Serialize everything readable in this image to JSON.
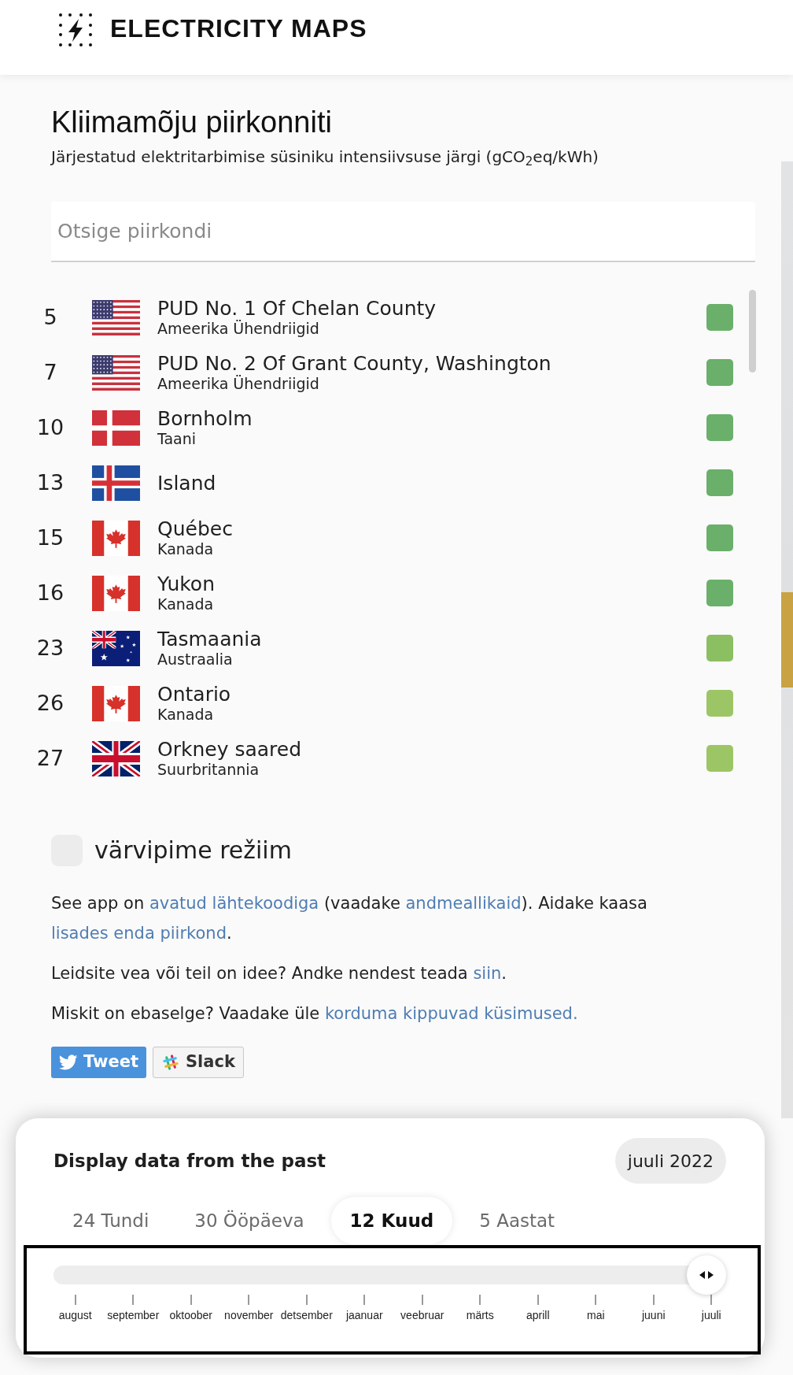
{
  "header": {
    "logo_text": "ELECTRICITY MAPS"
  },
  "ranking": {
    "title": "Kliimamõju piirkonniti",
    "subtitle": "Järjestatud elektritarbimise süsiniku intensiivsuse järgi (gCO$_{2}$eq/kWh)",
    "search": {
      "placeholder": "Otsige piirkondi"
    },
    "zones": [
      {
        "rank": "5",
        "kind": "us",
        "name": "PUD No. 1 Of Chelan County",
        "country": "Ameerika Ühendriigid",
        "color": "#6aaf6a"
      },
      {
        "rank": "7",
        "kind": "us",
        "name": "PUD No. 2 Of Grant County, Washington",
        "country": "Ameerika Ühendriigid",
        "color": "#6aaf6a"
      },
      {
        "rank": "10",
        "kind": "dk",
        "name": "Bornholm",
        "country": "Taani",
        "color": "#6aaf6a"
      },
      {
        "rank": "13",
        "kind": "is",
        "name": "Island",
        "color": "#6aaf6a"
      },
      {
        "rank": "15",
        "kind": "ca",
        "name": "Québec",
        "country": "Kanada",
        "color": "#6aaf6a"
      },
      {
        "rank": "16",
        "kind": "ca",
        "name": "Yukon",
        "country": "Kanada",
        "color": "#6aaf6a"
      },
      {
        "rank": "23",
        "kind": "au",
        "name": "Tasmaania",
        "country": "Austraalia",
        "color": "#8cbf62"
      },
      {
        "rank": "26",
        "kind": "ca",
        "name": "Ontario",
        "country": "Kanada",
        "color": "#9cc665"
      },
      {
        "rank": "27",
        "kind": "gb",
        "name": "Orkney saared",
        "country": "Suurbritannia",
        "color": "#9cc665"
      }
    ]
  },
  "colorblind_mode": {
    "label": "värvipime režiim",
    "checked": false
  },
  "info": [
    [
      {
        "kind": "text",
        "text": "See app on "
      },
      {
        "kind": "link",
        "text": "avatud lähtekoodiga"
      },
      {
        "kind": "text",
        "text": " (vaadake "
      },
      {
        "kind": "link",
        "text": "andmeallikaid"
      },
      {
        "kind": "text",
        "text": "). Aidake kaasa "
      },
      {
        "kind": "link",
        "text": "lisades enda piirkond"
      },
      {
        "kind": "text",
        "text": "."
      }
    ],
    [
      {
        "kind": "text",
        "text": "Leidsite vea või teil on idee? Andke nendest teada "
      },
      {
        "kind": "link",
        "text": "siin"
      },
      {
        "kind": "text",
        "text": "."
      }
    ],
    [
      {
        "kind": "text",
        "text": "Miskit on ebaselge? Vaadake üle "
      },
      {
        "kind": "link",
        "text": "korduma kippuvad küsimused."
      }
    ]
  ],
  "share_buttons": [
    {
      "kind": "twitter",
      "label": "Tweet"
    },
    {
      "kind": "slack",
      "label": "Slack"
    }
  ],
  "timeline": {
    "title": "Display data from the past",
    "date": "juuli 2022",
    "tabs": [
      {
        "label": "24 Tundi",
        "selected": false
      },
      {
        "label": "30 Ööpäeva",
        "selected": false
      },
      {
        "label": "12 Kuud",
        "selected": true
      },
      {
        "label": "5 Aastat",
        "selected": false
      }
    ],
    "slider": {
      "level": 1
    },
    "months": [
      "august",
      "september",
      "oktoober",
      "november",
      "detsember",
      "jaanuar",
      "veebruar",
      "märts",
      "aprill",
      "mai",
      "juuni",
      "juuli"
    ]
  }
}
